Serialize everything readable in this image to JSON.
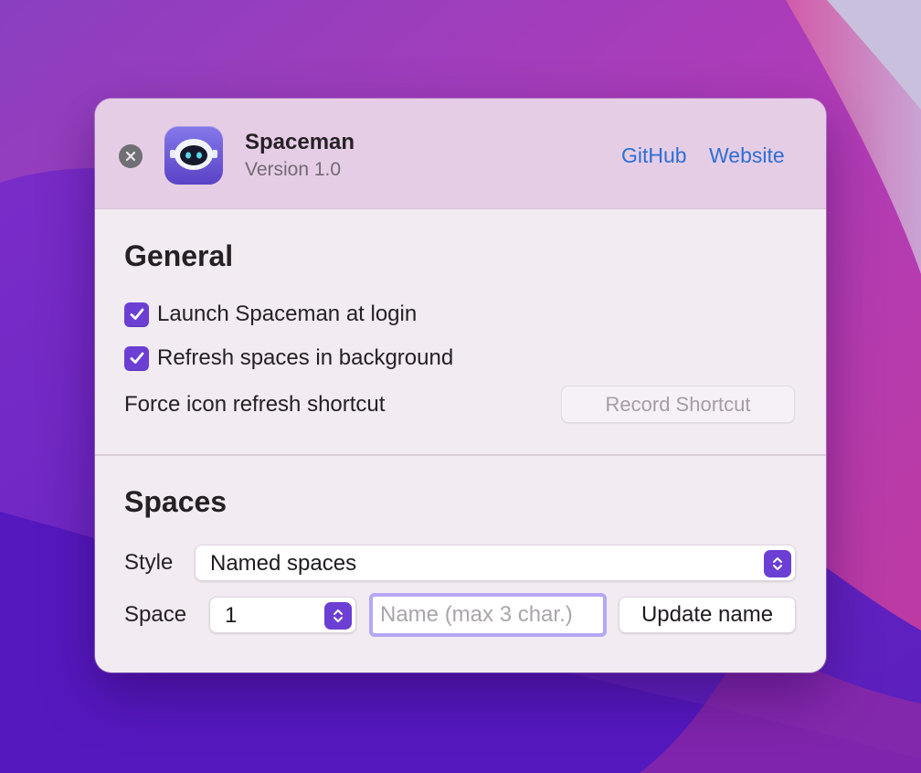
{
  "header": {
    "close_icon": "close-icon",
    "app_icon": "spaceman-robot-icon",
    "app_name": "Spaceman",
    "version": "Version 1.0",
    "links": {
      "github": "GitHub",
      "website": "Website"
    }
  },
  "general": {
    "title": "General",
    "launch_at_login": {
      "label": "Launch Spaceman at login",
      "checked": true
    },
    "refresh_in_background": {
      "label": "Refresh spaces in background",
      "checked": true
    },
    "shortcut_label": "Force icon refresh shortcut",
    "record_shortcut_label": "Record Shortcut"
  },
  "spaces": {
    "title": "Spaces",
    "style_label": "Style",
    "style_value": "Named spaces",
    "space_label": "Space",
    "space_value": "1",
    "name_placeholder": "Name (max 3 char.)",
    "name_value": "",
    "update_button": "Update name"
  },
  "colors": {
    "accent": "#6b3fd4",
    "link": "#2c6fd6",
    "header_bg": "#e6cde6",
    "window_bg": "#f2ebf2",
    "focus_ring": "#b4a7f4"
  }
}
